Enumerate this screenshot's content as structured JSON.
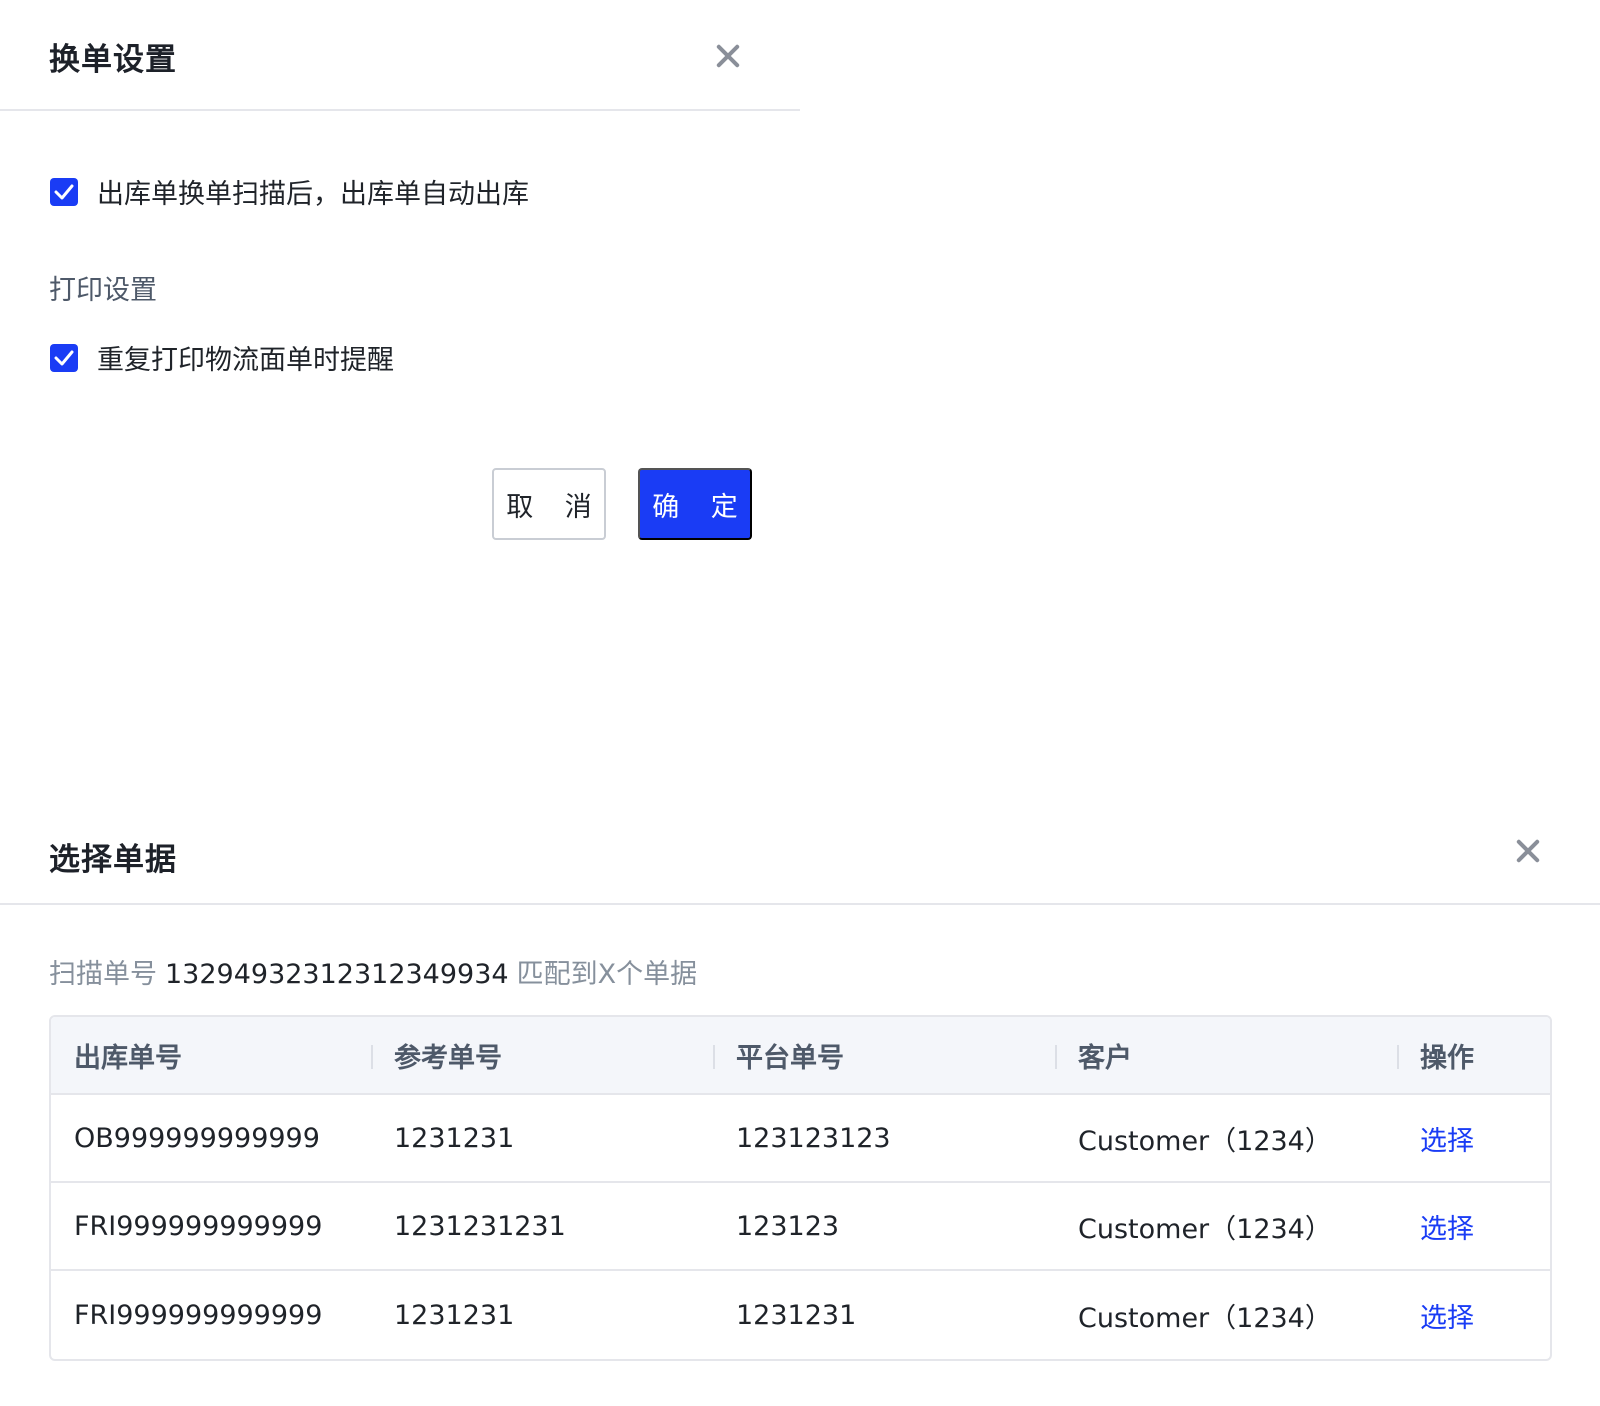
{
  "dialog1": {
    "title": "换单设置",
    "option1_label": "出库单换单扫描后，出库单自动出库",
    "option1_checked": true,
    "print_section_label": "打印设置",
    "option2_label": "重复打印物流面单时提醒",
    "option2_checked": true,
    "cancel_label": "取 消",
    "ok_label": "确 定"
  },
  "dialog2": {
    "title": "选择单据",
    "scan_prefix": "扫描单号",
    "scan_number": "13294932312312349934",
    "scan_suffix": "匹配到X个单据",
    "columns": [
      "出库单号",
      "参考单号",
      "平台单号",
      "客户",
      "操作"
    ],
    "rows": [
      {
        "outbound": "OB999999999999",
        "reference": "1231231",
        "platform": "123123123",
        "customer": "Customer（1234）",
        "action": "选择"
      },
      {
        "outbound": "FRI999999999999",
        "reference": "1231231231",
        "platform": "123123",
        "customer": "Customer（1234）",
        "action": "选择"
      },
      {
        "outbound": "FRI999999999999",
        "reference": "1231231",
        "platform": "1231231",
        "customer": "Customer（1234）",
        "action": "选择"
      }
    ]
  },
  "colors": {
    "primary": "#1a3cf5",
    "border": "#e5e6eb",
    "header_bg": "#f4f6fa",
    "muted_text": "#86909c"
  },
  "icons": {
    "close": "close-icon",
    "check": "check-icon"
  }
}
